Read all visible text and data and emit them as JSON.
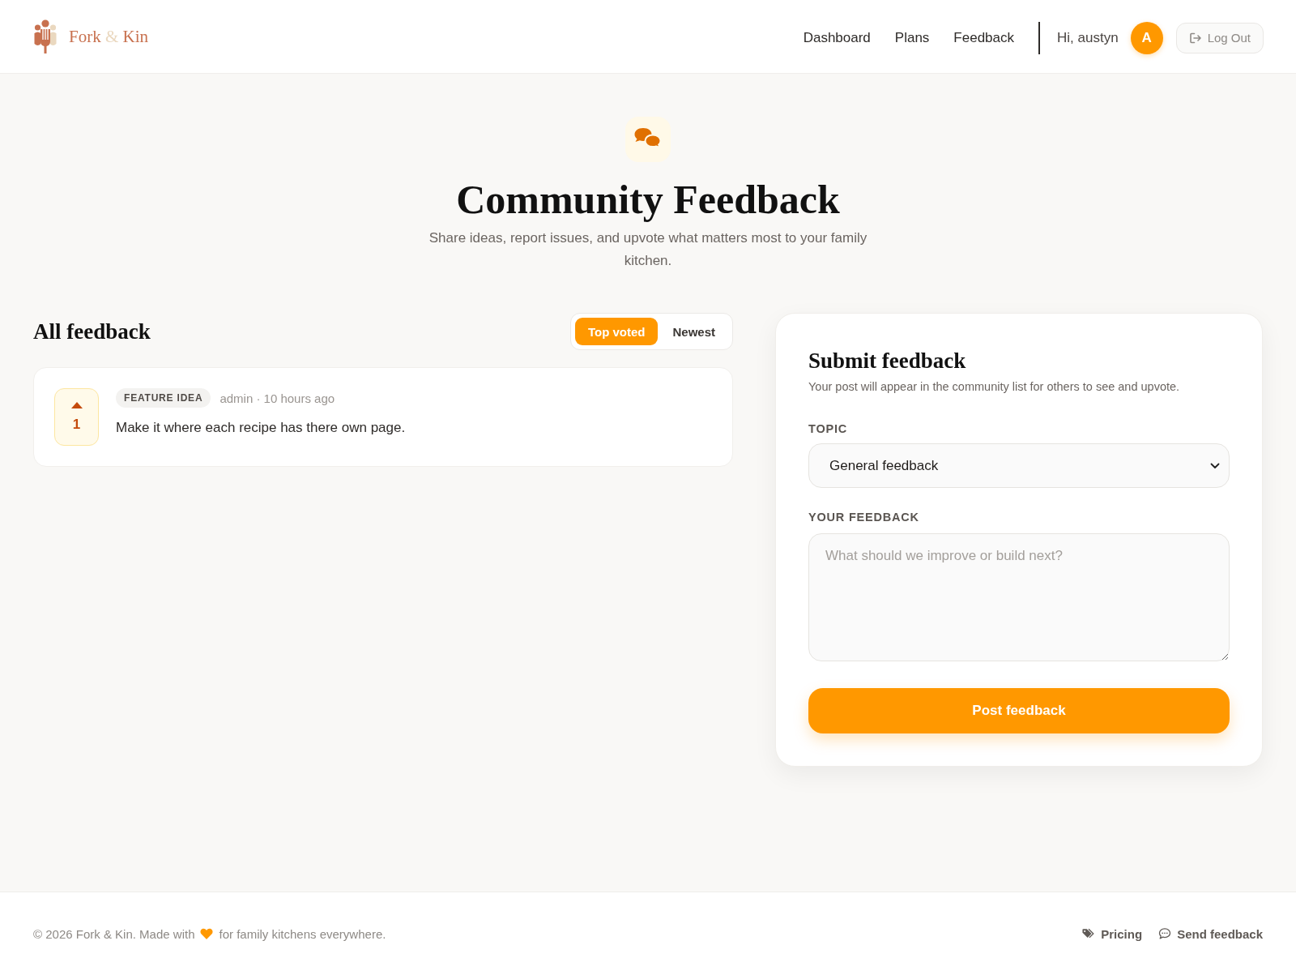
{
  "header": {
    "brand": {
      "first": "Fork",
      "amp": "&",
      "last": "Kin"
    },
    "nav_links": [
      "Dashboard",
      "Plans",
      "Feedback"
    ],
    "greeting": "Hi, austyn",
    "avatar_initial": "A",
    "logout": "Log Out"
  },
  "hero": {
    "title": "Community Feedback",
    "subtitle": "Share ideas, report issues, and upvote what matters most to your family kitchen."
  },
  "feedback_list": {
    "heading": "All feedback",
    "sort_options": [
      {
        "label": "Top voted",
        "selected": true
      },
      {
        "label": "Newest",
        "selected": false
      }
    ],
    "posts": [
      {
        "votes": "1",
        "tag": "FEATURE IDEA",
        "meta": "admin · 10 hours ago",
        "text": "Make it where each recipe has there own page."
      }
    ]
  },
  "submit_form": {
    "title": "Submit feedback",
    "subtitle": "Your post will appear in the community list for others to see and upvote.",
    "topic": {
      "label": "TOPIC",
      "value": "General feedback"
    },
    "feedback": {
      "label": "YOUR FEEDBACK",
      "placeholder": "What should we improve or build next?"
    },
    "submit": "Post feedback"
  },
  "footer": {
    "copyright_start": "© 2026 Fork & Kin. Made with",
    "copyright_end": "for family kitchens everywhere.",
    "pricing_link": "Pricing",
    "feedback_link": "Send feedback"
  }
}
